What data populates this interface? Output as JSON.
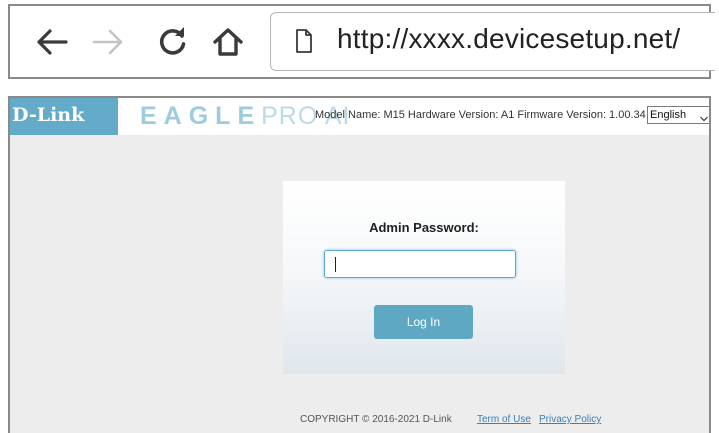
{
  "browser": {
    "url": "http://xxxx.devicesetup.net/",
    "icons": [
      "back-arrow-icon",
      "forward-arrow-icon",
      "reload-icon",
      "home-icon",
      "page-icon"
    ]
  },
  "header": {
    "logo": "D-Link",
    "product_bold": "EAGLE",
    "product_thin": "PRO AI",
    "info": "Model Name: M15 Hardware Version: A1 Firmware Version: 1.00.34",
    "language": "English",
    "brand_color": "#64aac9"
  },
  "login": {
    "label": "Admin Password:",
    "password_value": "",
    "button_label": "Log In",
    "button_color": "#5fa8c4"
  },
  "footer": {
    "copyright": "COPYRIGHT © 2016-2021 D-Link",
    "term_link": "Term of Use",
    "privacy_link": "Privacy Policy"
  }
}
